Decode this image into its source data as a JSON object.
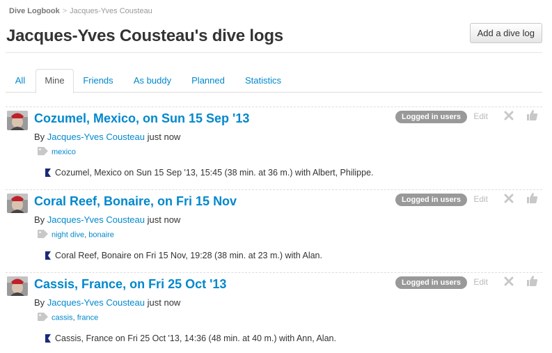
{
  "breadcrumb": {
    "root": "Dive Logbook",
    "separator": ">",
    "current": "Jacques-Yves Cousteau"
  },
  "page": {
    "title": "Jacques-Yves Cousteau's dive logs",
    "add_button": "Add a dive log"
  },
  "tabs": [
    {
      "label": "All",
      "active": false
    },
    {
      "label": "Mine",
      "active": true
    },
    {
      "label": "Friends",
      "active": false
    },
    {
      "label": "As buddy",
      "active": false
    },
    {
      "label": "Planned",
      "active": false
    },
    {
      "label": "Statistics",
      "active": false
    }
  ],
  "logs": [
    {
      "title": "Cozumel, Mexico, on Sun 15 Sep '13",
      "by_label": "By",
      "author": "Jacques-Yves Cousteau",
      "time": "just now",
      "tags": [
        "mexico"
      ],
      "tag_separator": ",",
      "summary": "Cozumel, Mexico on Sun 15 Sep '13, 15:45 (38 min. at 36 m.) with Albert, Philippe.",
      "badge": "Logged in users",
      "edit_label": "Edit"
    },
    {
      "title": "Coral Reef, Bonaire, on Fri 15 Nov",
      "by_label": "By",
      "author": "Jacques-Yves Cousteau",
      "time": "just now",
      "tags": [
        "night dive",
        "bonaire"
      ],
      "tag_separator": ",",
      "summary": "Coral Reef, Bonaire on Fri 15 Nov, 19:28 (38 min. at 23 m.) with Alan.",
      "badge": "Logged in users",
      "edit_label": "Edit"
    },
    {
      "title": "Cassis, France, on Fri 25 Oct '13",
      "by_label": "By",
      "author": "Jacques-Yves Cousteau",
      "time": "just now",
      "tags": [
        "cassis",
        "france"
      ],
      "tag_separator": ",",
      "summary": "Cassis, France on Fri 25 Oct '13, 14:36 (48 min. at 40 m.) with Ann, Alan.",
      "badge": "Logged in users",
      "edit_label": "Edit"
    }
  ],
  "icons": {
    "avatar": "user-avatar",
    "tag": "tag-icon",
    "flag": "dive-flag-icon",
    "delete": "close-x-icon",
    "like": "thumbs-up-icon"
  },
  "colors": {
    "link": "#0088cc",
    "badge": "#999999",
    "muted": "#bbbbbb",
    "flag": "#1a2a7a"
  }
}
